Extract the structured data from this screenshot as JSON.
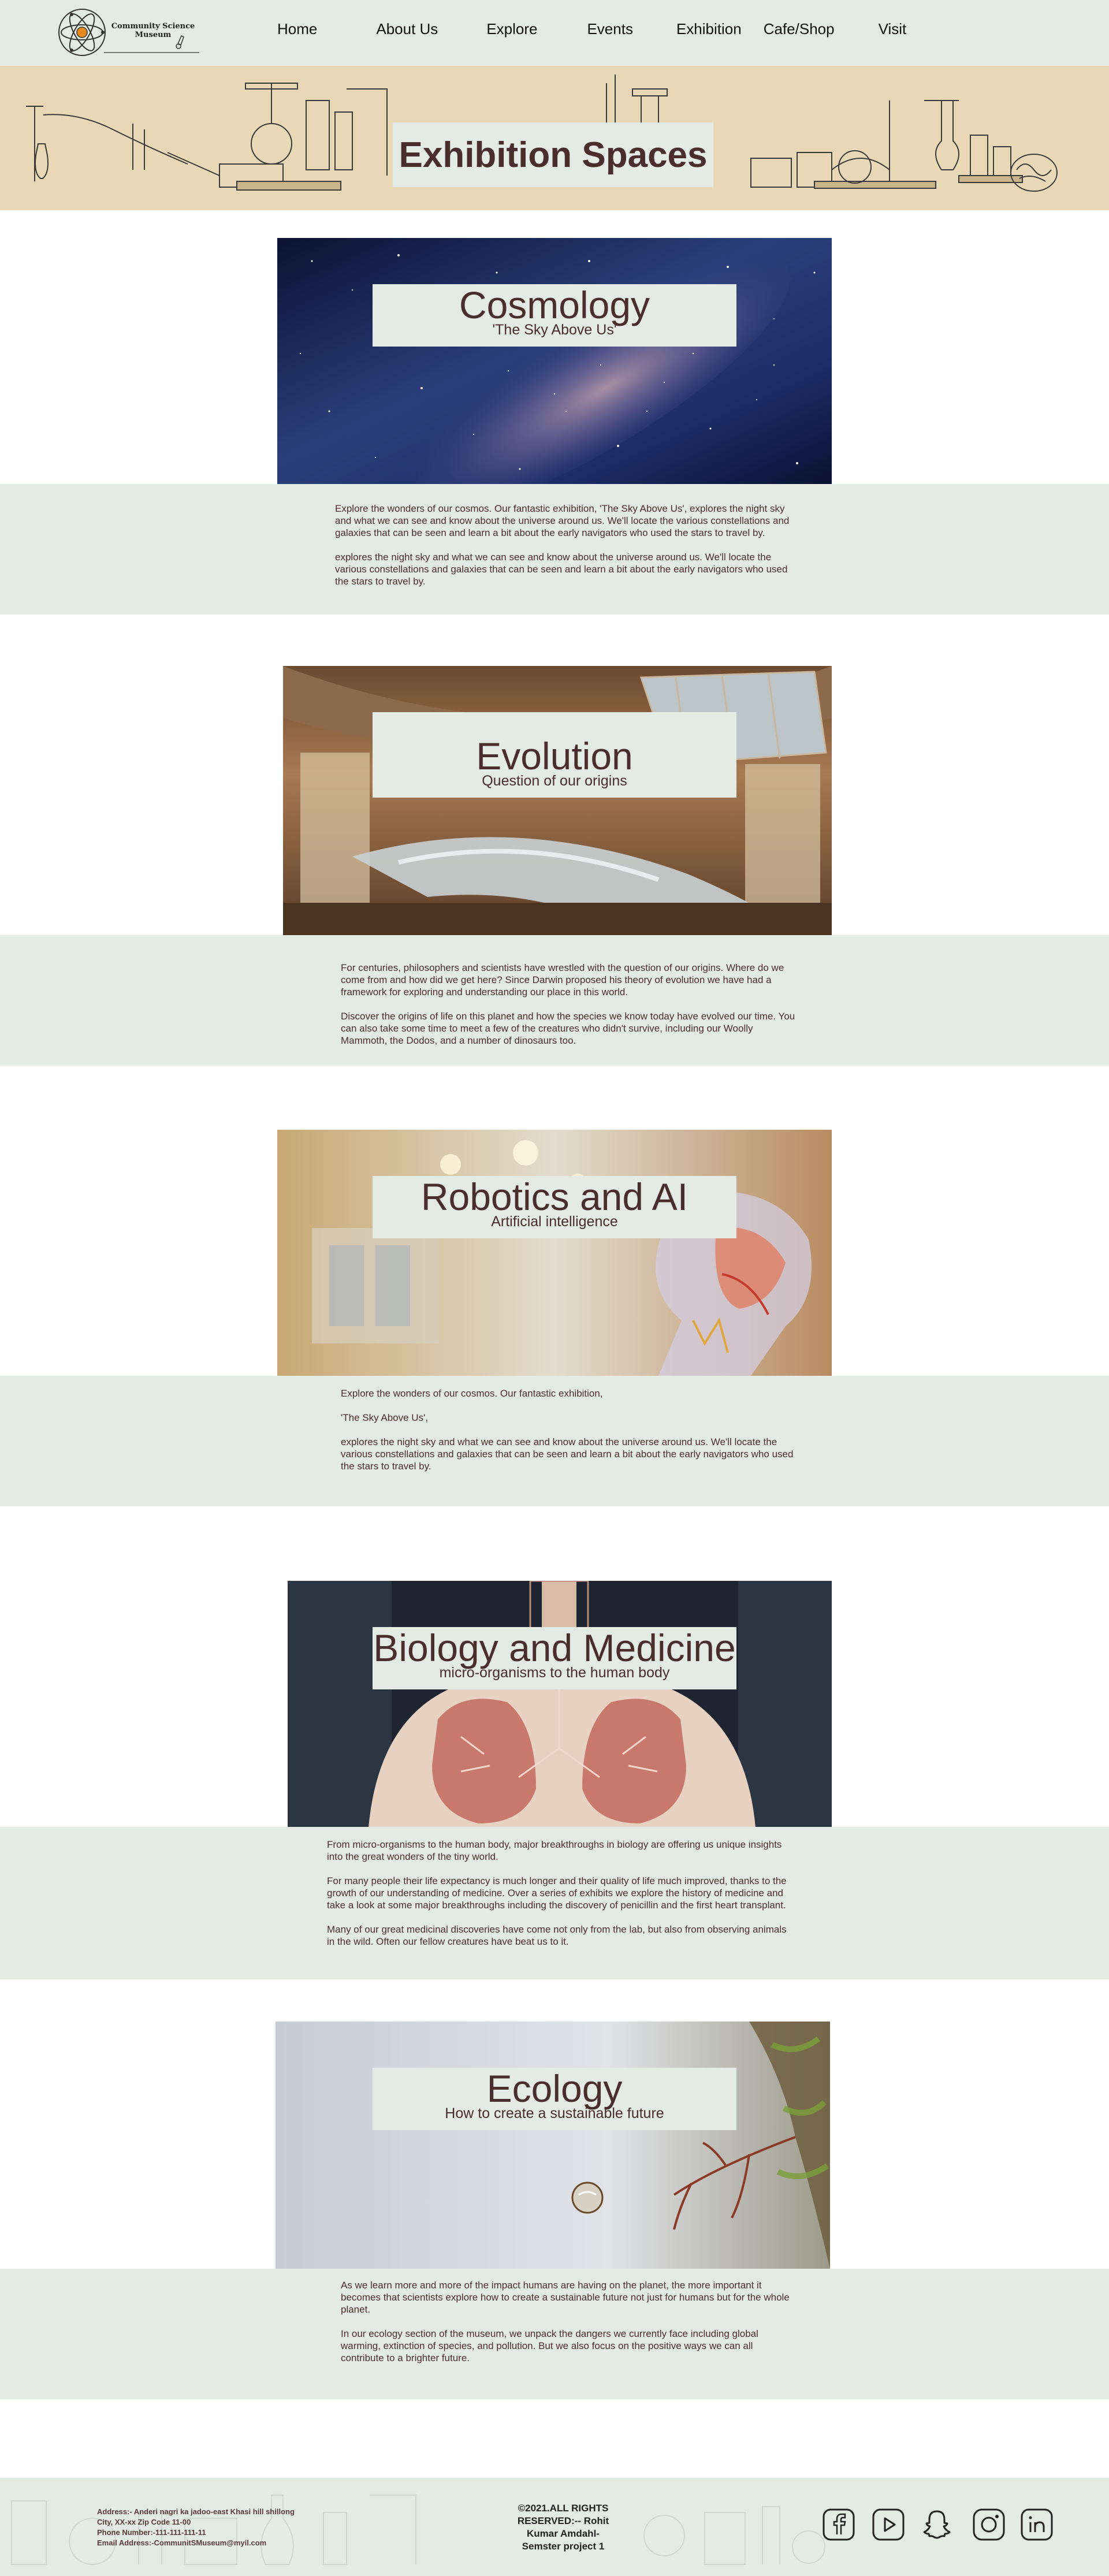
{
  "logo": {
    "line1": "Community Science",
    "line2": "Museum"
  },
  "nav": {
    "items": [
      {
        "label": "Home",
        "name": "home"
      },
      {
        "label": "About  Us",
        "name": "about-us"
      },
      {
        "label": "Explore",
        "name": "explore"
      },
      {
        "label": "Events",
        "name": "events"
      },
      {
        "label": "Exhibition",
        "name": "exhibition"
      },
      {
        "label": "Cafe/Shop",
        "name": "cafe-shop"
      },
      {
        "label": "Visit",
        "name": "visit"
      }
    ]
  },
  "hero": {
    "title": "Exhibition Spaces"
  },
  "exhibits": [
    {
      "title": "Cosmology",
      "subtitle": "'The Sky Above Us'",
      "image": "milky-way-starfield",
      "paragraphs": [
        "Explore the wonders of our cosmos. Our fantastic exhibition, 'The Sky Above Us', explores the night sky and what we can see and know about the universe around us. We'll locate the various constellations and galaxies that can be seen and learn a bit about the early navigators who used the stars to travel by.",
        "explores the night sky and what we can see and know about the universe around us. We'll locate the various constellations and galaxies that can be seen and learn a bit about the early navigators who used the stars to travel by."
      ]
    },
    {
      "title": "Evolution",
      "subtitle": "Question of our origins",
      "image": "museum-hall-whale-skeleton",
      "paragraphs": [
        "For centuries, philosophers and scientists have wrestled with the question of our origins. Where do we come from and how did we get here? Since Darwin proposed his theory of evolution we have had a framework for exploring and understanding our place in this world.",
        "Discover the origins of life on this planet and how the species we know today have evolved our time. You can also take some time to meet a few of the creatures who didn't survive, including our Woolly Mammoth, the Dodos, and a number of dinosaurs too."
      ]
    },
    {
      "title": "Robotics and AI",
      "subtitle": "Artificial intelligence",
      "image": "transparent-robot-head",
      "paragraphs": [
        "Explore the wonders of our cosmos. Our fantastic exhibition,",
        "'The Sky Above Us',",
        "explores the night sky and what we can see and know about the universe around us. We'll locate the various constellations and galaxies that can be seen and learn a bit about the early navigators who used the stars to travel by."
      ]
    },
    {
      "title": "Biology and Medicine",
      "subtitle": "micro-organisms to the human body",
      "image": "anatomical-lung-model",
      "paragraphs": [
        "From micro-organisms to the human body, major breakthroughs in biology are offering us unique insights into the great wonders of the tiny world.",
        "For many people their life expectancy is much longer and their quality of life much improved, thanks to the growth of our understanding of medicine. Over a series of exhibits we explore the history of medicine and take a look at some major breakthroughs including the discovery of penicillin and the first heart transplant.",
        "Many of our great medicinal discoveries have come not only from the lab, but also from observing animals in the wild. Often our fellow creatures have beat us to it."
      ]
    },
    {
      "title": "Ecology",
      "subtitle": "How to create a sustainable future",
      "image": "moss-branch-water-drop",
      "paragraphs": [
        "As we learn more and more of the impact humans are having on the planet, the more important it becomes that scientists explore how to create a sustainable future not just for humans but for the whole planet.",
        "In our ecology section of the museum, we unpack the dangers we currently face including global warming, extinction of species, and pollution. But we also focus on the positive ways we can all contribute to a brighter future."
      ]
    }
  ],
  "footer": {
    "address_lines": [
      "Address:- Anderi nagri ka jadoo-east Khasi hill shillong",
      "City, XX-xx Zip Code 11-00",
      "Phone Number:-111-111-111-11",
      "Email Address:-CommunitSMuseum@myil.com"
    ],
    "rights_lines": [
      "©2021.ALL RIGHTS",
      "RESERVED:-- Rohit",
      "Kumar Amdahl-",
      "Semster project 1"
    ],
    "social": [
      "facebook-icon",
      "youtube-icon",
      "snapchat-icon",
      "instagram-icon",
      "linkedin-icon"
    ]
  },
  "colors": {
    "nav_bg": "#e4ebe4",
    "hero_bg": "#e8d8b5",
    "title_text": "#4a2d2d",
    "panel_bg": "#e4ebe4"
  }
}
